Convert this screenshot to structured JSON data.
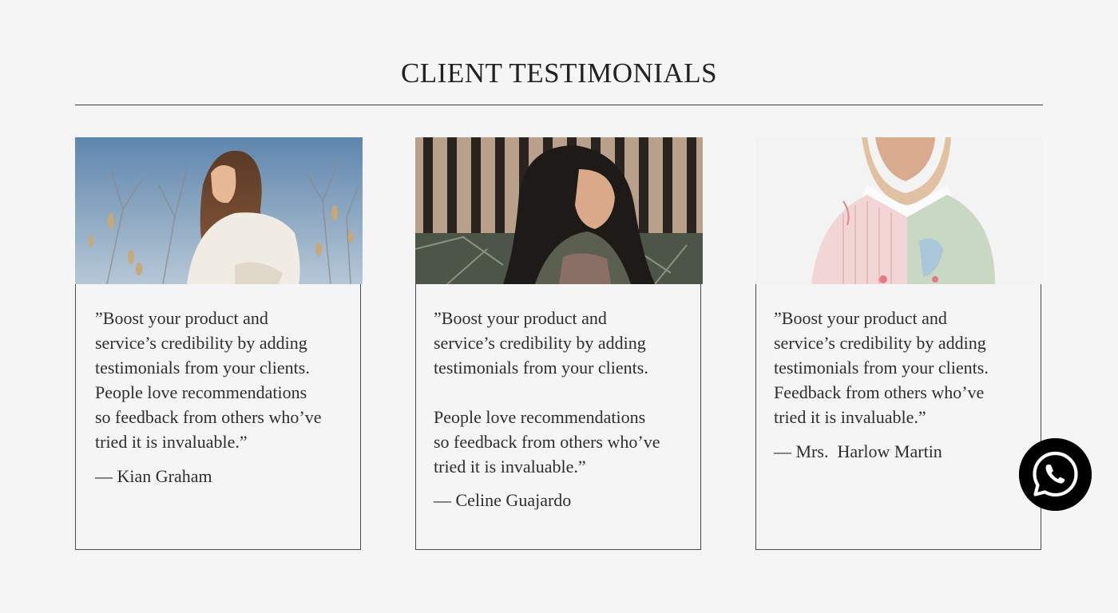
{
  "section": {
    "title": "CLIENT TESTIMONIALS"
  },
  "testimonials": [
    {
      "quote": "”Boost your product and\nservice’s credibility by adding\ntestimonials from your clients.\nPeople love recommendations\nso feedback from others who’ve\ntried it is invaluable.”",
      "author": "— Kian Graham",
      "photo_icon": "woman-in-field-photo"
    },
    {
      "quote": "”Boost your product and\nservice’s credibility by adding\ntestimonials from your clients.\n\nPeople love recommendations\nso feedback from others who’ve\ntried it is invaluable.”",
      "author": "— Celine Guajardo",
      "photo_icon": "woman-with-dark-hair-photo"
    },
    {
      "quote": "”Boost your product and\nservice’s credibility by adding\ntestimonials from your clients.\nFeedback from others who’ve\ntried it is invaluable.”",
      "author": "— Mrs.  Harlow Martin",
      "photo_icon": "model-in-hijab-photo"
    }
  ],
  "whatsapp": {
    "icon": "whatsapp-icon",
    "color": "#000000"
  },
  "colors": {
    "background": "#f5f5f5",
    "text": "#2e2e2e",
    "border": "#4a4a4a"
  }
}
